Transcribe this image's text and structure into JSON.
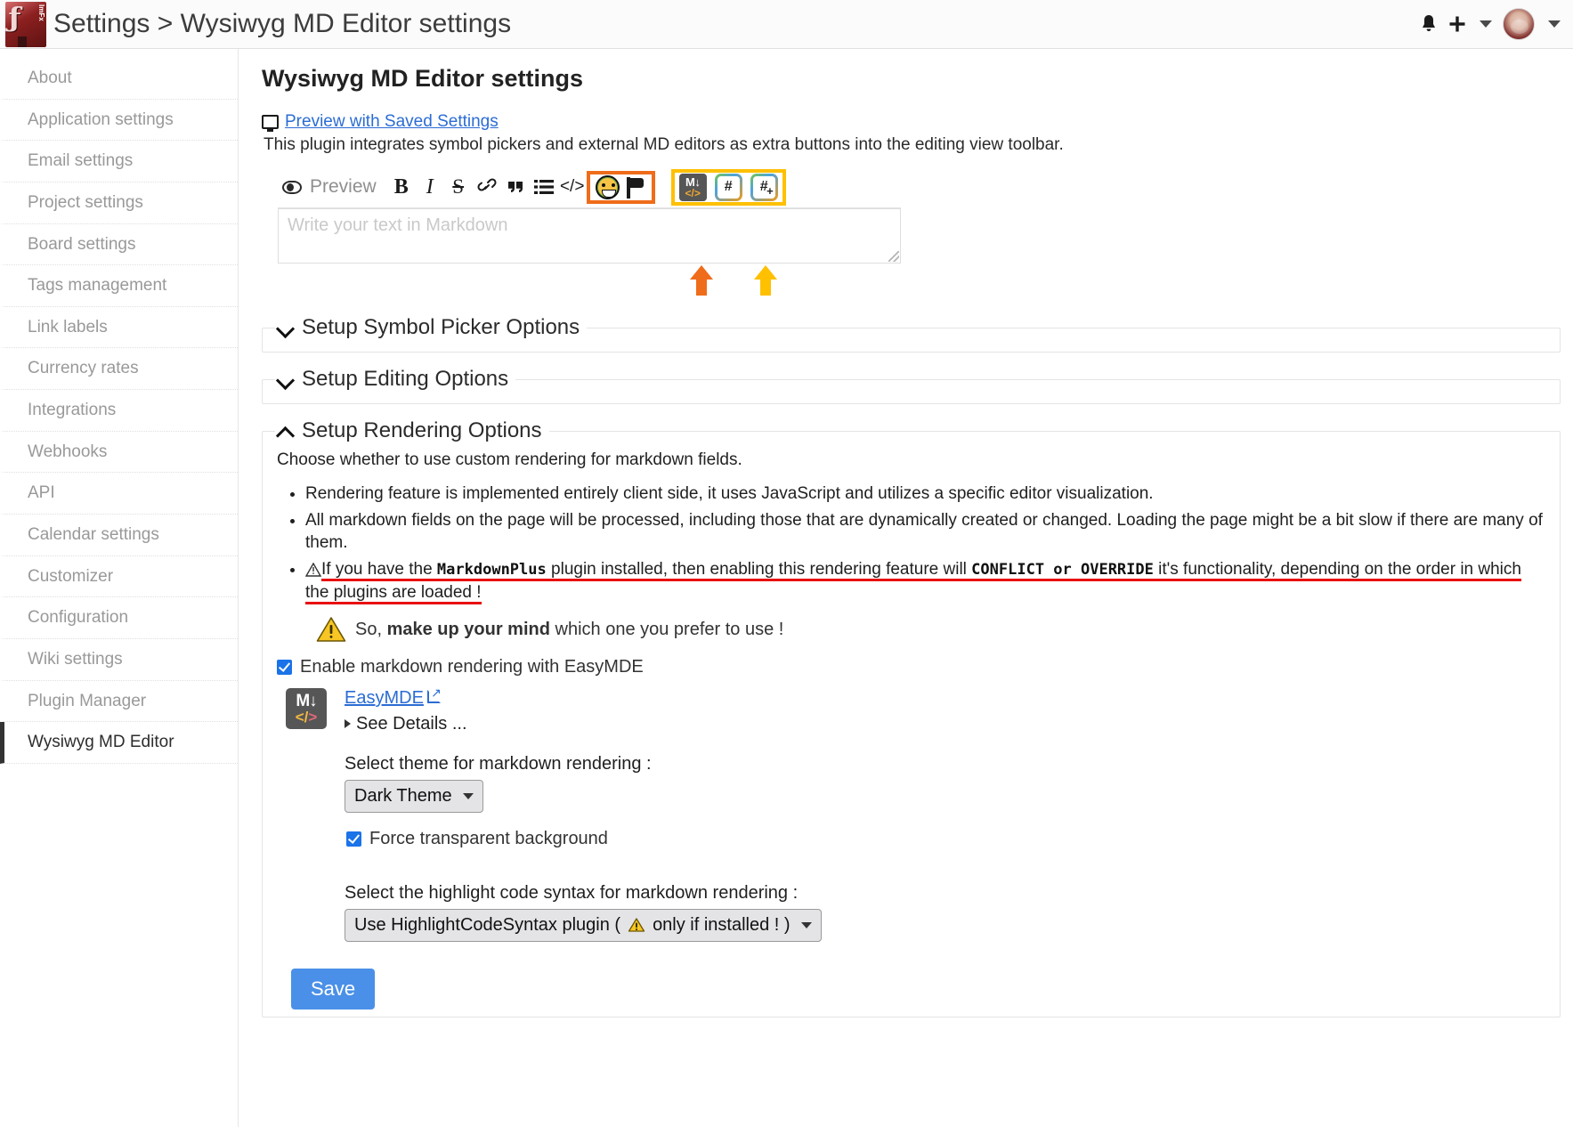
{
  "header": {
    "breadcrumb": "Settings > Wysiwyg MD Editor settings",
    "logo_glyph": "ƒ",
    "logo_text": "ImFx",
    "icons": {
      "bell": "🔔",
      "plus": "+"
    }
  },
  "sidebar": {
    "items": [
      {
        "label": "About",
        "active": false
      },
      {
        "label": "Application settings",
        "active": false
      },
      {
        "label": "Email settings",
        "active": false
      },
      {
        "label": "Project settings",
        "active": false
      },
      {
        "label": "Board settings",
        "active": false
      },
      {
        "label": "Tags management",
        "active": false
      },
      {
        "label": "Link labels",
        "active": false
      },
      {
        "label": "Currency rates",
        "active": false
      },
      {
        "label": "Integrations",
        "active": false
      },
      {
        "label": "Webhooks",
        "active": false
      },
      {
        "label": "API",
        "active": false
      },
      {
        "label": "Calendar settings",
        "active": false
      },
      {
        "label": "Customizer",
        "active": false
      },
      {
        "label": "Configuration",
        "active": false
      },
      {
        "label": "Wiki settings",
        "active": false
      },
      {
        "label": "Plugin Manager",
        "active": false
      },
      {
        "label": "Wysiwyg MD Editor",
        "active": true
      }
    ]
  },
  "main": {
    "page_title": "Wysiwyg MD Editor settings",
    "preview_link": "Preview with Saved Settings",
    "description": "This plugin integrates symbol pickers and external MD editors as extra buttons into the editing view toolbar.",
    "editor": {
      "preview_label": "Preview",
      "bold": "B",
      "italic": "I",
      "strike": "S",
      "link": "🔗",
      "quote": "”",
      "list": "☰",
      "code": "</>",
      "md_icon_top": "M↓",
      "md_icon_bottom": "</>",
      "hash": "#",
      "hash_plus_sub": "+",
      "placeholder": "Write your text in Markdown"
    },
    "sections": {
      "symbol_picker": "Setup Symbol Picker Options",
      "editing": "Setup Editing Options",
      "rendering": "Setup Rendering Options"
    },
    "rendering": {
      "intro": "Choose whether to use custom rendering for markdown fields.",
      "bullets": [
        "Rendering feature is implemented entirely client side, it uses JavaScript and utilizes a specific editor visualization.",
        "All markdown fields on the page will be processed, including those that are dynamically created or changed. Loading the page might be a bit slow if there are many of them."
      ],
      "warning_bullet": {
        "pre": "If you have the ",
        "code1": "MarkdownPlus",
        "mid": " plugin installed, then enabling this rendering feature will ",
        "code2": "CONFLICT or OVERRIDE",
        "post": " it's functionality, depending on the order in which the plugins are loaded !"
      },
      "mind_pre": "So, ",
      "mind_bold": "make up your mind",
      "mind_post": " which one you prefer to use !",
      "enable_checkbox_label": "Enable markdown rendering with EasyMDE",
      "enable_checked": true,
      "easymde_link": "EasyMDE",
      "see_details": "See Details ...",
      "theme_label": "Select theme for markdown rendering :",
      "theme_value": "Dark Theme",
      "theme_options": [
        "Dark Theme"
      ],
      "transparent_label": "Force transparent background",
      "transparent_checked": true,
      "highlight_label": "Select the highlight code syntax for markdown rendering :",
      "highlight_value_pre": "Use HighlightCodeSyntax plugin ( ",
      "highlight_value_post": " only if installed ! )"
    },
    "save_label": "Save"
  },
  "colors": {
    "accent_link": "#2b6cd4",
    "checkbox": "#1a73e8",
    "save_button": "#4a90e8",
    "highlight_orange": "#ef6c1a",
    "highlight_yellow": "#ffc000",
    "warning_red": "#e81010"
  }
}
